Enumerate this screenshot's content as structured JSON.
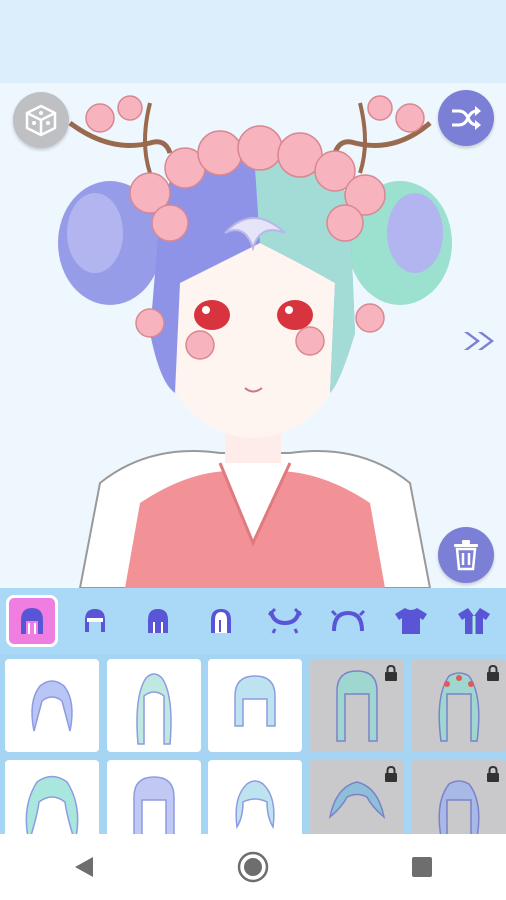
{
  "app": {
    "toolbar": {
      "random_icon": "dice-icon",
      "shuffle_icon": "shuffle-icon",
      "next_icon": "double-chevron-right-icon",
      "delete_icon": "trash-icon"
    },
    "tabs": [
      {
        "icon": "hair-full-icon",
        "active": true
      },
      {
        "icon": "hair-front-icon",
        "active": false
      },
      {
        "icon": "hair-middle-icon",
        "active": false
      },
      {
        "icon": "hair-back-icon",
        "active": false
      },
      {
        "icon": "horns-icon",
        "active": false
      },
      {
        "icon": "headband-icon",
        "active": false
      },
      {
        "icon": "shirt-icon",
        "active": false
      },
      {
        "icon": "jacket-icon",
        "active": false
      }
    ],
    "items": [
      {
        "style": "hair-1",
        "locked": false
      },
      {
        "style": "hair-2",
        "locked": false
      },
      {
        "style": "hair-3",
        "locked": false
      },
      {
        "style": "hair-4",
        "locked": true
      },
      {
        "style": "hair-5",
        "locked": true
      },
      {
        "style": "hair-6",
        "locked": false
      },
      {
        "style": "hair-7",
        "locked": false
      },
      {
        "style": "hair-8",
        "locked": false
      },
      {
        "style": "hair-9",
        "locked": true
      },
      {
        "style": "hair-10",
        "locked": true
      }
    ],
    "navbar": {
      "back_icon": "back-triangle-icon",
      "home_icon": "home-circle-icon",
      "recents_icon": "recents-square-icon"
    },
    "colors": {
      "accent": "#7c7fd6",
      "active_tab": "#f07ee0",
      "tab_bar": "#aad8f7",
      "hair_blue": "#8f93e8",
      "hair_mint": "#a9ecd7",
      "blossom": "#f7b4be",
      "kimono": "#f28f92"
    }
  }
}
